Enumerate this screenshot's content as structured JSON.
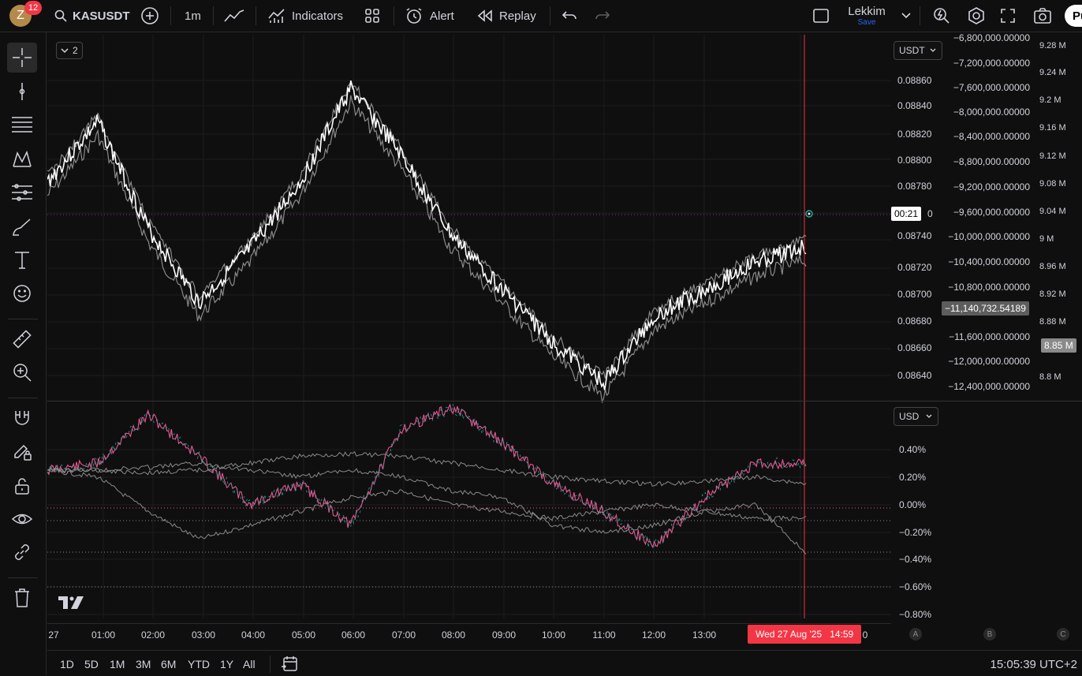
{
  "toolbar": {
    "avatar_letter": "Z",
    "notification_count": "12",
    "symbol": "KASUSDT",
    "interval": "1m",
    "indicators_label": "Indicators",
    "alert_label": "Alert",
    "replay_label": "Replay",
    "layout_name": "Lekkim",
    "save_label": "Save",
    "publish_label": "Pu"
  },
  "legend": {
    "collapse_count": "2"
  },
  "main_pane": {
    "currency_label": "USDT",
    "price_ticks": [
      "0.08860",
      "0.08840",
      "0.08820",
      "0.08800",
      "0.08780",
      "0.08740",
      "0.08720",
      "0.08700",
      "0.08680",
      "0.08660",
      "0.08640"
    ],
    "countdown": "00:21",
    "countdown_suffix": "0",
    "secondary_ticks": [
      "−6,800,000.00000",
      "−7,200,000.00000",
      "−7,600,000.00000",
      "−8,000,000.00000",
      "−8,400,000.00000",
      "−8,800,000.00000",
      "−9,200,000.00000",
      "−9,600,000.00000",
      "−10,000,000.00000",
      "−10,400,000.00000",
      "−10,800,000.00000",
      "−11,600,000.00000",
      "−12,000,000.00000",
      "−12,400,000.00000"
    ],
    "secondary_last": "−11,140,732.54189",
    "volume_ticks": [
      "9.28 M",
      "9.24 M",
      "9.2 M",
      "9.16 M",
      "9.12 M",
      "9.08 M",
      "9.04 M",
      "9 M",
      "8.96 M",
      "8.92 M",
      "8.88 M",
      "8.84 M",
      "8.8 M"
    ],
    "volume_last": "8.85 M"
  },
  "lower_pane": {
    "currency_label": "USD",
    "pct_ticks": [
      "0.40%",
      "0.20%",
      "0.00%",
      "−0.20%",
      "−0.40%",
      "−0.60%",
      "−0.80%"
    ]
  },
  "time_axis": {
    "labels": [
      "27",
      "01:00",
      "02:00",
      "03:00",
      "04:00",
      "05:00",
      "06:00",
      "07:00",
      "08:00",
      "09:00",
      "10:00",
      "11:00",
      "12:00",
      "13:00",
      "1",
      "0"
    ],
    "crosshair_label": "Wed 27 Aug '25   14:59",
    "scale_labels": [
      "A",
      "B",
      "C"
    ]
  },
  "bottom_bar": {
    "ranges": [
      "1D",
      "5D",
      "1M",
      "3M",
      "6M",
      "YTD",
      "1Y",
      "All"
    ],
    "clock": "15:05:39 UTC+2"
  },
  "colors": {
    "background": "#0f0f0f",
    "price_line": "#ffffff",
    "compare_line": "#8a8a8a",
    "crosshair": "#f23645",
    "price_level": "#9c27b0",
    "up": "#26a69a",
    "down": "#ef5391"
  },
  "chart_data": {
    "type": "line",
    "x": [
      "00:00",
      "01:00",
      "02:00",
      "03:00",
      "04:00",
      "05:00",
      "06:00",
      "07:00",
      "08:00",
      "09:00",
      "10:00",
      "11:00",
      "12:00",
      "13:00",
      "14:00",
      "14:59"
    ],
    "series": [
      {
        "name": "KASUSDT",
        "values": [
          0.0881,
          0.08855,
          0.08775,
          0.0872,
          0.0876,
          0.0881,
          0.0888,
          0.0883,
          0.0877,
          0.0873,
          0.0869,
          0.0866,
          0.0871,
          0.0873,
          0.0875,
          0.08762
        ]
      }
    ],
    "ylim": [
      0.0863,
      0.0888
    ],
    "secondary_range": [
      -12400000,
      -6800000
    ],
    "volume_range": [
      8.8,
      9.28
    ],
    "lower_pane": {
      "type": "line",
      "series": [
        {
          "values": [
            0.0,
            0.05,
            0.4,
            0.1,
            -0.25,
            -0.1,
            -0.4,
            0.3,
            0.45,
            0.2,
            -0.1,
            -0.3,
            -0.55,
            -0.2,
            0.05,
            0.05
          ]
        },
        {
          "values": [
            0.0,
            0.0,
            -0.02,
            0.0,
            0.05,
            0.1,
            0.12,
            0.1,
            0.05,
            0.0,
            -0.05,
            -0.08,
            -0.1,
            -0.08,
            -0.05,
            -0.1
          ]
        },
        {
          "values": [
            0.0,
            -0.05,
            -0.3,
            -0.5,
            -0.4,
            -0.3,
            -0.2,
            -0.15,
            -0.25,
            -0.3,
            -0.35,
            -0.3,
            -0.25,
            -0.3,
            -0.35,
            -0.35
          ]
        },
        {
          "values": [
            0.0,
            0.0,
            0.02,
            0.05,
            0.0,
            -0.05,
            0.0,
            -0.05,
            -0.15,
            -0.2,
            -0.4,
            -0.45,
            -0.4,
            -0.3,
            -0.25,
            -0.6
          ]
        }
      ],
      "ylim": [
        -0.8,
        0.4
      ]
    }
  }
}
